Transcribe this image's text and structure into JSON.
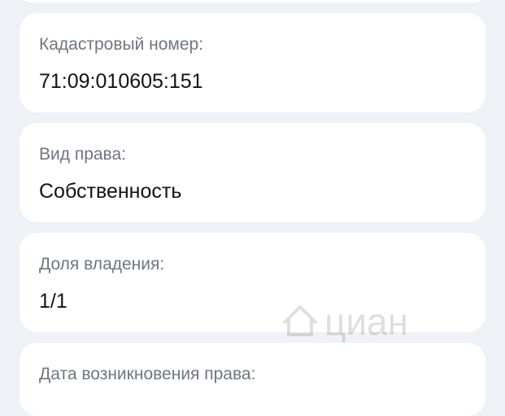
{
  "fields": [
    {
      "label": "Кадастровый номер:",
      "value": "71:09:010605:151"
    },
    {
      "label": "Вид права:",
      "value": "Собственность"
    },
    {
      "label": "Доля владения:",
      "value": "1/1"
    },
    {
      "label": "Дата возникновения права:",
      "value": ""
    }
  ],
  "watermark": {
    "text": "циан",
    "icon": "cian-house-logo-icon"
  }
}
